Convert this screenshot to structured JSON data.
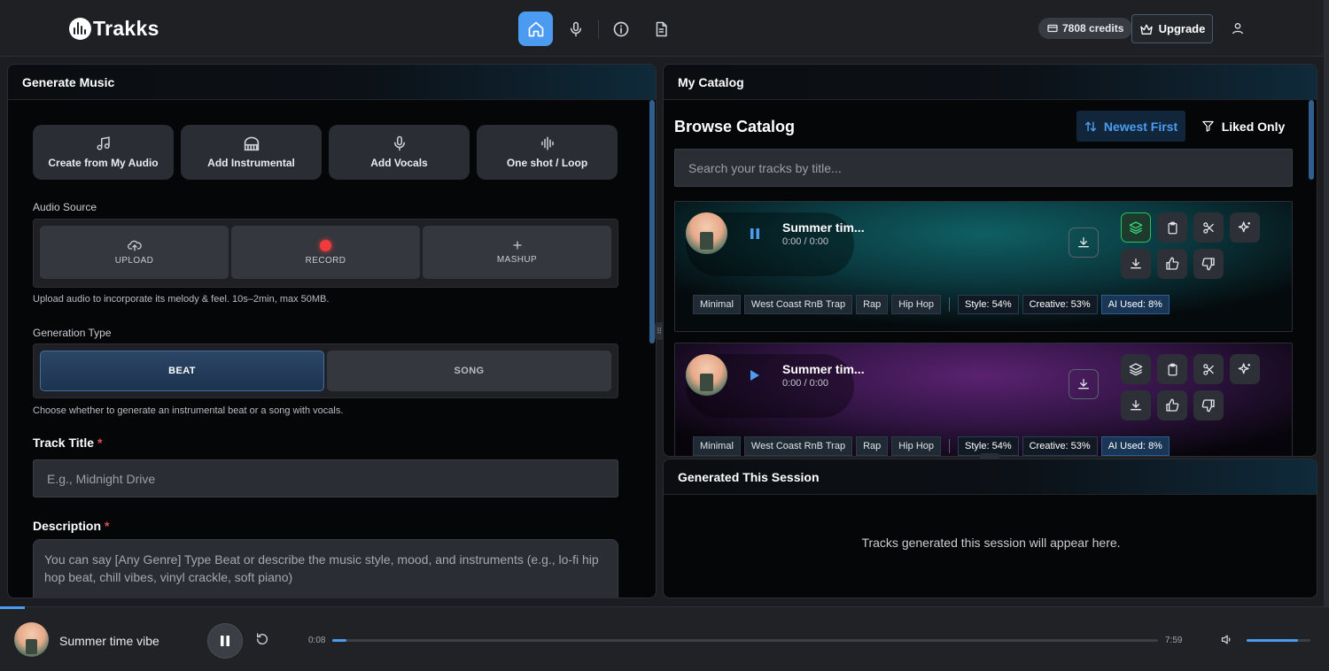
{
  "app": {
    "logo_text": "Trakks"
  },
  "header": {
    "nav": [
      "home",
      "microphone",
      "info",
      "document"
    ],
    "credits": "7808 credits",
    "upgrade_label": "Upgrade"
  },
  "generate": {
    "panel_title": "Generate Music",
    "modes": [
      "Create from My Audio",
      "Add Instrumental",
      "Add Vocals",
      "One shot / Loop"
    ],
    "audio_source_label": "Audio Source",
    "sources": [
      "UPLOAD",
      "RECORD",
      "MASHUP"
    ],
    "source_hint": "Upload audio to incorporate its melody & feel. 10s–2min, max 50MB.",
    "gen_type_label": "Generation Type",
    "types": [
      "BEAT",
      "SONG"
    ],
    "selected_type": "BEAT",
    "type_hint": "Choose whether to generate an instrumental beat or a song with vocals.",
    "track_title_label": "Track Title",
    "track_title_placeholder": "E.g., Midnight Drive",
    "description_label": "Description",
    "description_placeholder": "You can say [Any Genre] Type Beat or describe the music style, mood, and instruments (e.g., lo-fi hip hop beat, chill vibes, vinyl crackle, soft piano)",
    "required_mark": "*"
  },
  "catalog": {
    "panel_title": "My Catalog",
    "browse_title": "Browse Catalog",
    "sort_label": "Newest First",
    "liked_label": "Liked Only",
    "search_placeholder": "Search your tracks by title...",
    "tracks": [
      {
        "title": "Summer tim...",
        "time": "0:00 / 0:00",
        "playing": true,
        "tags": [
          "Minimal",
          "West Coast RnB Trap",
          "Rap",
          "Hip Hop"
        ],
        "style": "Style: 54%",
        "creative": "Creative: 53%",
        "ai_used": "AI Used: 8%"
      },
      {
        "title": "Summer tim...",
        "time": "0:00 / 0:00",
        "playing": false,
        "tags": [
          "Minimal",
          "West Coast RnB Trap",
          "Rap",
          "Hip Hop"
        ],
        "style": "Style: 54%",
        "creative": "Creative: 53%",
        "ai_used": "AI Used: 8%"
      }
    ]
  },
  "session": {
    "panel_title": "Generated This Session",
    "empty_text": "Tracks generated this session will appear here."
  },
  "player": {
    "title": "Summer time vibe",
    "current": "0:08",
    "duration": "7:59",
    "progress_fraction": 0.017,
    "volume_fraction": 0.8
  },
  "colors": {
    "accent": "#4b9bf0",
    "record": "#ef3b3b",
    "liked_green": "#3fd57e"
  }
}
